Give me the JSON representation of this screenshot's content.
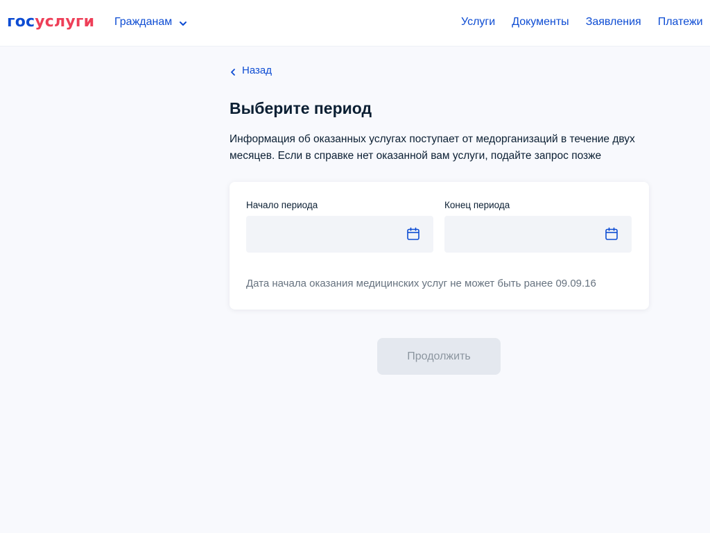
{
  "header": {
    "logo": {
      "part1": "гос",
      "part2": "услуги"
    },
    "audience_menu": {
      "label": "Гражданам",
      "icon": "chevron-down-icon"
    },
    "nav": [
      "Услуги",
      "Документы",
      "Заявления",
      "Платежи"
    ]
  },
  "main": {
    "back_label": "Назад",
    "title": "Выберите период",
    "intro": "Информация об оказанных услугах поступает от медорганизаций в течение двух месяцев. Если в справке нет оказанной вам услуги, подайте запрос позже",
    "start_field": {
      "label": "Начало периода",
      "value": "",
      "icon": "calendar-icon"
    },
    "end_field": {
      "label": "Конец периода",
      "value": "",
      "icon": "calendar-icon"
    },
    "hint": "Дата начала оказания медицинских услуг не может быть ранее 09.09.16",
    "continue_label": "Продолжить"
  },
  "colors": {
    "brand_blue": "#0d4cd3",
    "brand_red": "#ee3f58",
    "background": "#f8f9fd",
    "input_bg": "#f2f4f8",
    "button_disabled_bg": "#e4e8ef",
    "button_disabled_text": "#8b959f"
  }
}
